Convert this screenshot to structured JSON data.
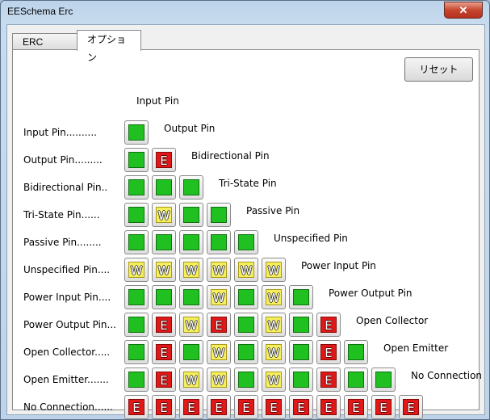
{
  "window": {
    "title": "EESchema Erc",
    "close_glyph": "✕"
  },
  "tabs": [
    {
      "label": "ERC",
      "active": false
    },
    {
      "label": "オプション",
      "active": true
    }
  ],
  "reset_button": "リセット",
  "pins": [
    {
      "row": "Input Pin..........",
      "col": "Input Pin"
    },
    {
      "row": "Output Pin.........",
      "col": "Output Pin"
    },
    {
      "row": "Bidirectional Pin..",
      "col": "Bidirectional Pin"
    },
    {
      "row": "Tri-State Pin......",
      "col": "Tri-State Pin"
    },
    {
      "row": "Passive Pin........",
      "col": "Passive Pin"
    },
    {
      "row": "Unspecified Pin....",
      "col": "Unspecified Pin"
    },
    {
      "row": "Power Input Pin....",
      "col": "Power Input Pin"
    },
    {
      "row": "Power Output Pin...",
      "col": "Power Output Pin"
    },
    {
      "row": "Open Collector.....",
      "col": "Open Collector"
    },
    {
      "row": "Open Emitter.......",
      "col": "Open Emitter"
    },
    {
      "row": "No Connection......",
      "col": "No Connection"
    }
  ],
  "legend": {
    "ok": "",
    "warning": "W",
    "error": "E"
  },
  "matrix": [
    [
      "ok"
    ],
    [
      "ok",
      "error"
    ],
    [
      "ok",
      "ok",
      "ok"
    ],
    [
      "ok",
      "warning",
      "ok",
      "ok"
    ],
    [
      "ok",
      "ok",
      "ok",
      "ok",
      "ok"
    ],
    [
      "warning",
      "warning",
      "warning",
      "warning",
      "warning",
      "warning"
    ],
    [
      "ok",
      "ok",
      "ok",
      "warning",
      "ok",
      "warning",
      "ok"
    ],
    [
      "ok",
      "error",
      "warning",
      "error",
      "ok",
      "warning",
      "ok",
      "error"
    ],
    [
      "ok",
      "error",
      "ok",
      "warning",
      "ok",
      "warning",
      "ok",
      "error",
      "ok"
    ],
    [
      "ok",
      "error",
      "warning",
      "warning",
      "ok",
      "warning",
      "ok",
      "error",
      "ok",
      "ok"
    ],
    [
      "error",
      "error",
      "error",
      "error",
      "error",
      "error",
      "error",
      "error",
      "error",
      "error",
      "error"
    ]
  ],
  "colors": {
    "ok": "#20c020",
    "warning": "#f6ef5c",
    "error": "#e01818"
  }
}
